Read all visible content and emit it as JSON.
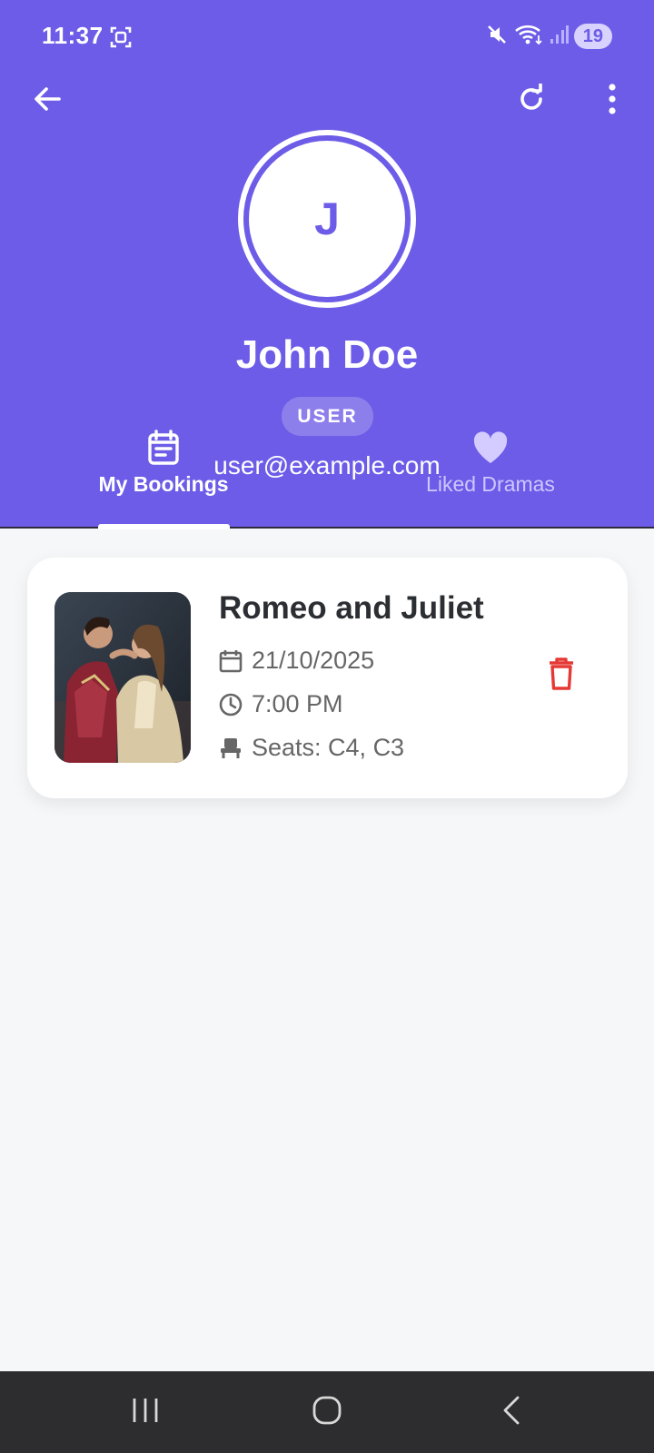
{
  "status_bar": {
    "time": "11:37",
    "battery": "19"
  },
  "profile": {
    "initial": "J",
    "name": "John Doe",
    "role": "USER",
    "email": "user@example.com"
  },
  "tabs": [
    {
      "label": "My Bookings",
      "icon": "calendar-note-icon",
      "selected": true
    },
    {
      "label": "Liked Dramas",
      "icon": "heart-icon",
      "selected": false
    }
  ],
  "bookings": [
    {
      "title": "Romeo and Juliet",
      "date": "21/10/2025",
      "time": "7:00 PM",
      "seats": "Seats: C4, C3"
    }
  ],
  "colors": {
    "primary": "#6c5ce7",
    "delete": "#e53935",
    "background": "#f6f7f9"
  }
}
